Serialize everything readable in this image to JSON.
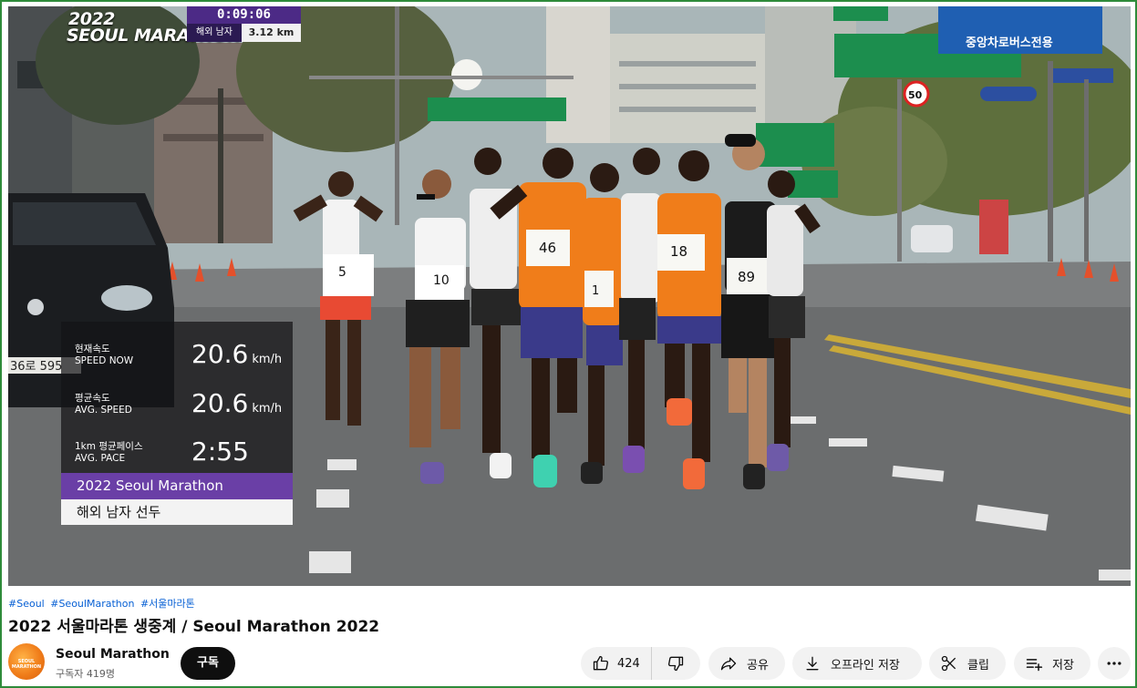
{
  "video": {
    "brand_overlay": {
      "year": "2022",
      "name": "SEOUL MARATHON"
    },
    "timer": {
      "elapsed": "0:09:06",
      "label": "해외 남자",
      "distance": "3.12 km"
    },
    "stats": [
      {
        "label_ko": "현재속도",
        "label_en": "SPEED NOW",
        "value": "20.6",
        "unit": "km/h"
      },
      {
        "label_ko": "평균속도",
        "label_en": "AVG. SPEED",
        "value": "20.6",
        "unit": "km/h"
      },
      {
        "label_ko": "1km 평균페이스",
        "label_en": "AVG. PACE",
        "value": "2:55",
        "unit": ""
      }
    ],
    "event_name": "2022 Seoul Marathon",
    "group_name": "해외 남자 선두",
    "scene": {
      "speed_limit": "50",
      "road_sign": "중앙차로버스전용",
      "bibs": [
        "5",
        "10",
        "46",
        "1",
        "18",
        "89"
      ],
      "car_plate": "36로 595"
    }
  },
  "hashtags": [
    "#Seoul",
    "#SeoulMarathon",
    "#서울마라톤"
  ],
  "title": "2022 서울마라톤 생중계 / Seoul Marathon 2022",
  "channel": {
    "name": "Seoul Marathon",
    "subscribers": "구독자 419명",
    "avatar_text": "SEOUL MARATHON"
  },
  "actions": {
    "subscribe": "구독",
    "like_count": "424",
    "share": "공유",
    "offline_save": "오프라인 저장",
    "clip": "클립",
    "save": "저장"
  },
  "icons": [
    "thumbs-up-icon",
    "thumbs-down-icon",
    "share-icon",
    "download-icon",
    "scissors-icon",
    "playlist-add-icon",
    "more-icon"
  ],
  "colors": {
    "accent_purple": "#6a3fa6",
    "runner_orange": "#f07d1a",
    "subscribe_bg": "#0f0f0f",
    "link_blue": "#065fd4"
  }
}
